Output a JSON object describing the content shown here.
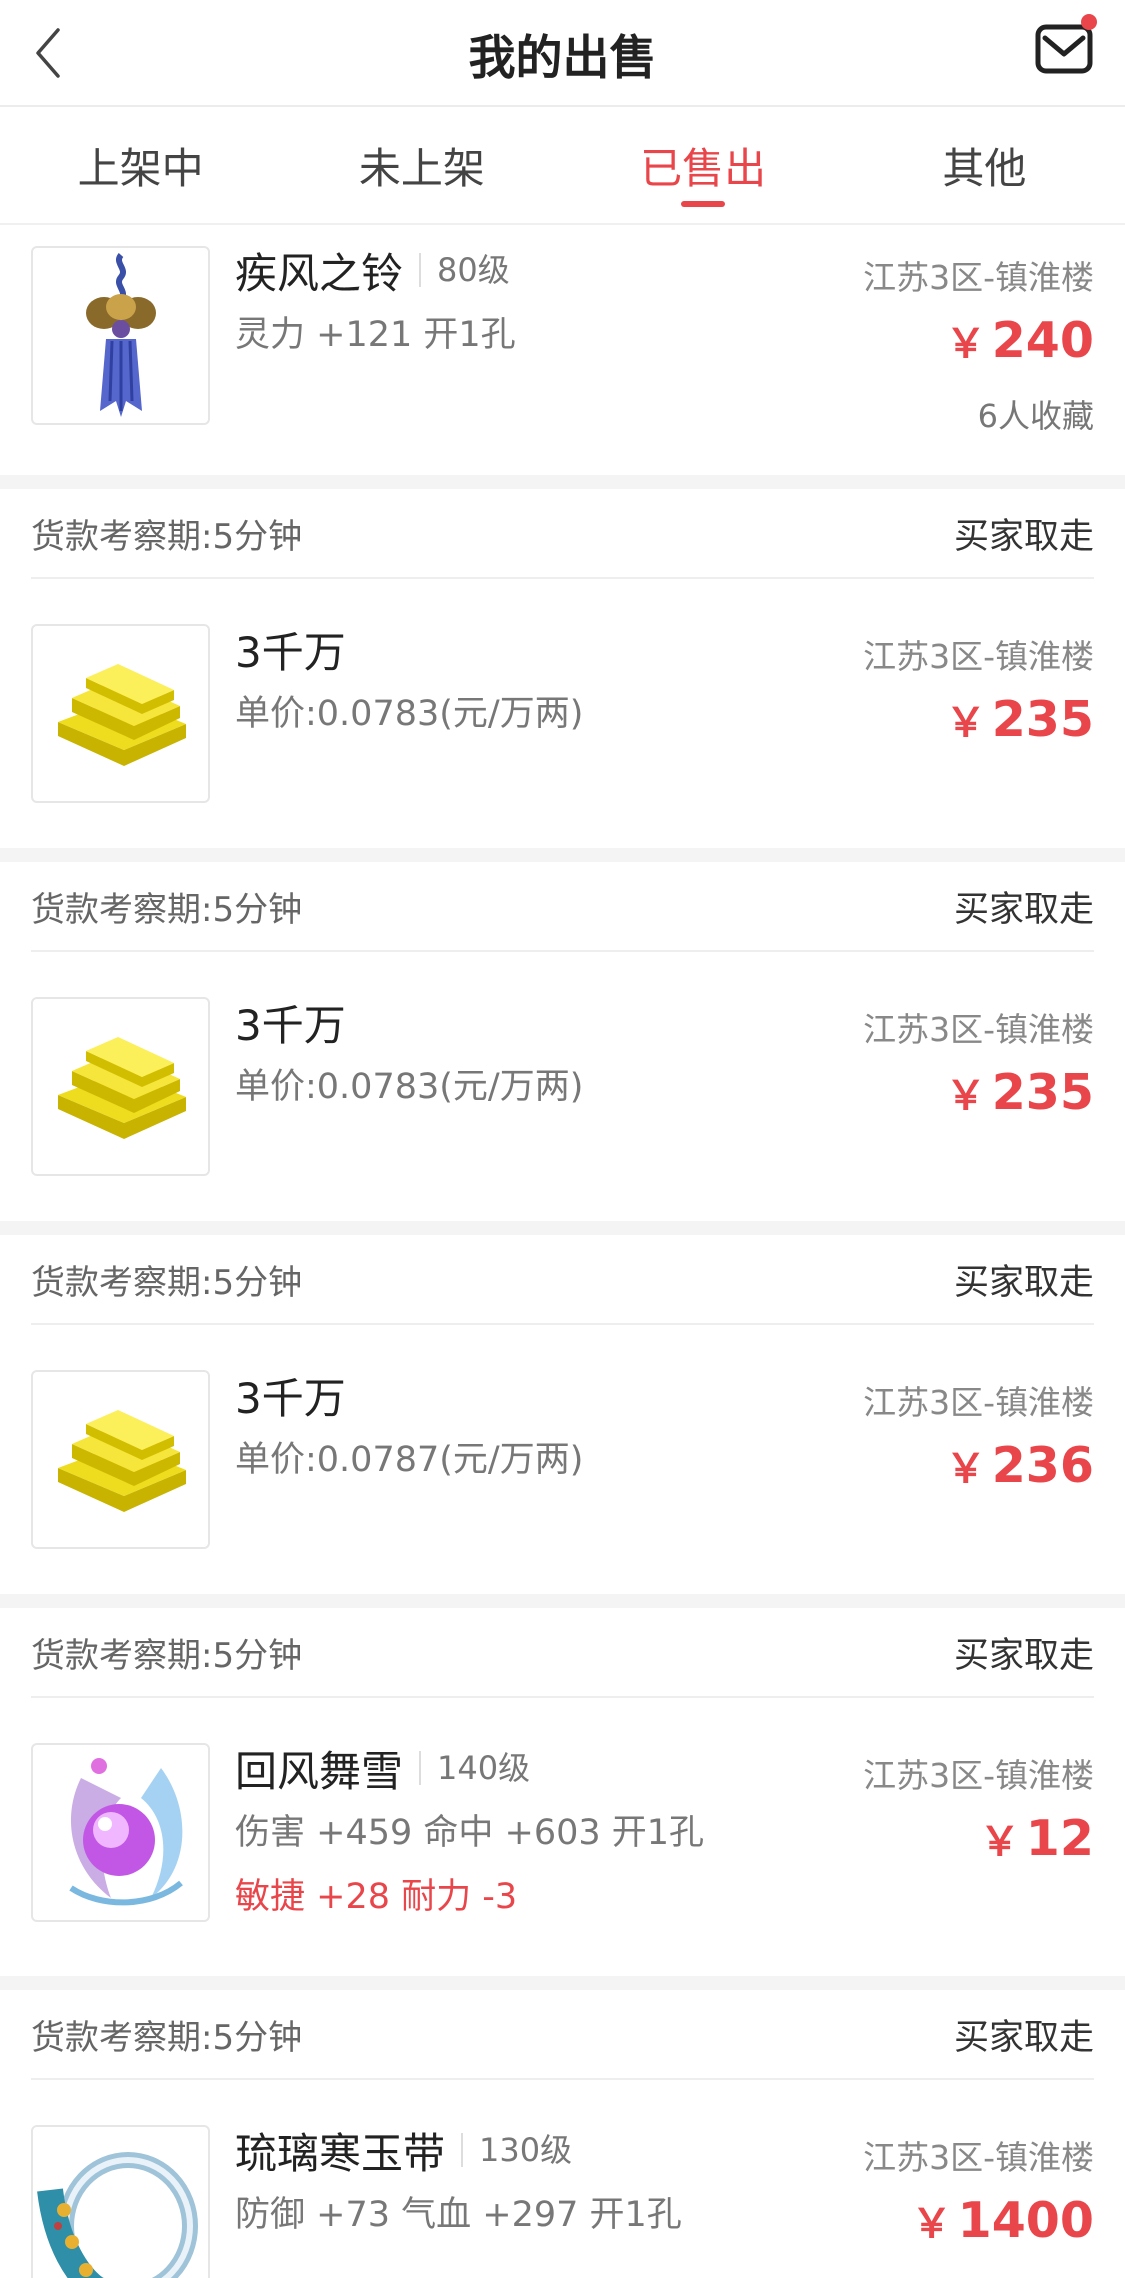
{
  "header": {
    "title": "我的出售",
    "back_icon": "chevron-left-icon",
    "mail_icon": "mail-icon",
    "badge_color": "#e8464a"
  },
  "tabs": [
    {
      "label": "上架中",
      "active": false
    },
    {
      "label": "未上架",
      "active": false
    },
    {
      "label": "已售出",
      "active": true
    },
    {
      "label": "其他",
      "active": false
    }
  ],
  "accent_color": "#e8464a",
  "items": [
    {
      "name": "疾风之铃",
      "level": "80级",
      "server": "江苏3区-镇淮楼",
      "price": "240",
      "currency": "￥",
      "attr": "灵力 +121 开1孔",
      "favorites": "6人收藏",
      "thumb_icon": "bell-pendant-icon"
    },
    {
      "meta_left": "货款考察期:5分钟",
      "meta_right": "买家取走",
      "name": "3千万",
      "server": "江苏3区-镇淮楼",
      "price": "235",
      "currency": "￥",
      "attr": "单价:0.0783(元/万两)",
      "thumb_icon": "gold-bars-icon"
    },
    {
      "meta_left": "货款考察期:5分钟",
      "meta_right": "买家取走",
      "name": "3千万",
      "server": "江苏3区-镇淮楼",
      "price": "235",
      "currency": "￥",
      "attr": "单价:0.0783(元/万两)",
      "thumb_icon": "gold-bars-icon"
    },
    {
      "meta_left": "货款考察期:5分钟",
      "meta_right": "买家取走",
      "name": "3千万",
      "server": "江苏3区-镇淮楼",
      "price": "236",
      "currency": "￥",
      "attr": "单价:0.0787(元/万两)",
      "thumb_icon": "gold-bars-icon"
    },
    {
      "meta_left": "货款考察期:5分钟",
      "meta_right": "买家取走",
      "name": "回风舞雪",
      "level": "140级",
      "server": "江苏3区-镇淮楼",
      "price": "12",
      "currency": "￥",
      "attr": "伤害 +459 命中 +603 开1孔",
      "extra_attr": "敏捷 +28 耐力 -3",
      "thumb_icon": "magic-orb-icon"
    },
    {
      "meta_left": "货款考察期:5分钟",
      "meta_right": "买家取走",
      "name": "琉璃寒玉带",
      "level": "130级",
      "server": "江苏3区-镇淮楼",
      "price": "1400",
      "currency": "￥",
      "attr": "防御 +73 气血 +297 开1孔",
      "thumb_icon": "jade-belt-icon"
    }
  ]
}
